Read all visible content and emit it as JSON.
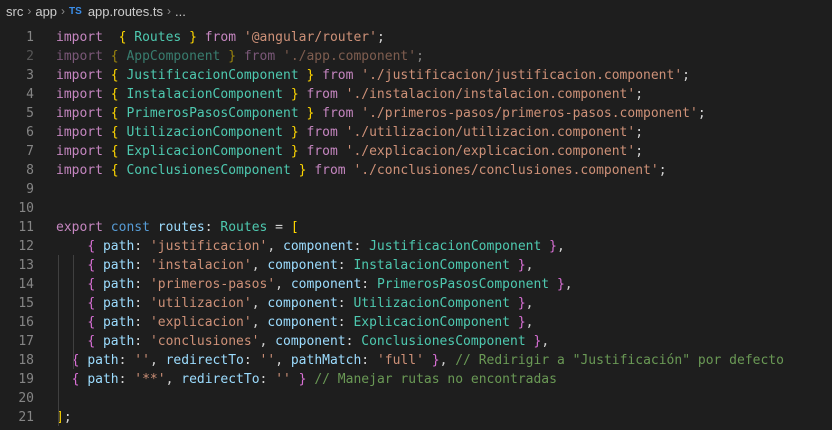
{
  "breadcrumb": {
    "segments": [
      "src",
      "app"
    ],
    "file_icon": "TS",
    "file_name": "app.routes.ts",
    "tail": "..."
  },
  "editor": {
    "language": "typescript",
    "lines": [
      {
        "n": "1",
        "tokens": [
          [
            "kw",
            "import"
          ],
          [
            "",
            "  "
          ],
          [
            "br1",
            "{"
          ],
          [
            "",
            " "
          ],
          [
            "ty",
            "Routes"
          ],
          [
            "",
            " "
          ],
          [
            "br1",
            "}"
          ],
          [
            "",
            " "
          ],
          [
            "kw",
            "from"
          ],
          [
            "",
            " "
          ],
          [
            "str",
            "'@angular/router'"
          ],
          [
            "",
            ";"
          ]
        ]
      },
      {
        "n": "2",
        "dim": true,
        "tokens": [
          [
            "kw",
            "import"
          ],
          [
            "",
            " "
          ],
          [
            "br1",
            "{"
          ],
          [
            "",
            " "
          ],
          [
            "ty",
            "AppComponent"
          ],
          [
            "",
            " "
          ],
          [
            "br1",
            "}"
          ],
          [
            "",
            " "
          ],
          [
            "kw",
            "from"
          ],
          [
            "",
            " "
          ],
          [
            "str",
            "'./app.component'"
          ],
          [
            "",
            ";"
          ]
        ]
      },
      {
        "n": "3",
        "tokens": [
          [
            "kw",
            "import"
          ],
          [
            "",
            " "
          ],
          [
            "br1",
            "{"
          ],
          [
            "",
            " "
          ],
          [
            "ty",
            "JustificacionComponent"
          ],
          [
            "",
            " "
          ],
          [
            "br1",
            "}"
          ],
          [
            "",
            " "
          ],
          [
            "kw",
            "from"
          ],
          [
            "",
            " "
          ],
          [
            "str",
            "'./justificacion/justificacion.component'"
          ],
          [
            "",
            ";"
          ]
        ]
      },
      {
        "n": "4",
        "tokens": [
          [
            "kw",
            "import"
          ],
          [
            "",
            " "
          ],
          [
            "br1",
            "{"
          ],
          [
            "",
            " "
          ],
          [
            "ty",
            "InstalacionComponent"
          ],
          [
            "",
            " "
          ],
          [
            "br1",
            "}"
          ],
          [
            "",
            " "
          ],
          [
            "kw",
            "from"
          ],
          [
            "",
            " "
          ],
          [
            "str",
            "'./instalacion/instalacion.component'"
          ],
          [
            "",
            ";"
          ]
        ]
      },
      {
        "n": "5",
        "tokens": [
          [
            "kw",
            "import"
          ],
          [
            "",
            " "
          ],
          [
            "br1",
            "{"
          ],
          [
            "",
            " "
          ],
          [
            "ty",
            "PrimerosPasosComponent"
          ],
          [
            "",
            " "
          ],
          [
            "br1",
            "}"
          ],
          [
            "",
            " "
          ],
          [
            "kw",
            "from"
          ],
          [
            "",
            " "
          ],
          [
            "str",
            "'./primeros-pasos/primeros-pasos.component'"
          ],
          [
            "",
            ";"
          ]
        ]
      },
      {
        "n": "6",
        "tokens": [
          [
            "kw",
            "import"
          ],
          [
            "",
            " "
          ],
          [
            "br1",
            "{"
          ],
          [
            "",
            " "
          ],
          [
            "ty",
            "UtilizacionComponent"
          ],
          [
            "",
            " "
          ],
          [
            "br1",
            "}"
          ],
          [
            "",
            " "
          ],
          [
            "kw",
            "from"
          ],
          [
            "",
            " "
          ],
          [
            "str",
            "'./utilizacion/utilizacion.component'"
          ],
          [
            "",
            ";"
          ]
        ]
      },
      {
        "n": "7",
        "tokens": [
          [
            "kw",
            "import"
          ],
          [
            "",
            " "
          ],
          [
            "br1",
            "{"
          ],
          [
            "",
            " "
          ],
          [
            "ty",
            "ExplicacionComponent"
          ],
          [
            "",
            " "
          ],
          [
            "br1",
            "}"
          ],
          [
            "",
            " "
          ],
          [
            "kw",
            "from"
          ],
          [
            "",
            " "
          ],
          [
            "str",
            "'./explicacion/explicacion.component'"
          ],
          [
            "",
            ";"
          ]
        ]
      },
      {
        "n": "8",
        "tokens": [
          [
            "kw",
            "import"
          ],
          [
            "",
            " "
          ],
          [
            "br1",
            "{"
          ],
          [
            "",
            " "
          ],
          [
            "ty",
            "ConclusionesComponent"
          ],
          [
            "",
            " "
          ],
          [
            "br1",
            "}"
          ],
          [
            "",
            " "
          ],
          [
            "kw",
            "from"
          ],
          [
            "",
            " "
          ],
          [
            "str",
            "'./conclusiones/conclusiones.component'"
          ],
          [
            "",
            ";"
          ]
        ]
      },
      {
        "n": "9",
        "tokens": []
      },
      {
        "n": "10",
        "tokens": []
      },
      {
        "n": "11",
        "tokens": [
          [
            "kw",
            "export"
          ],
          [
            "",
            " "
          ],
          [
            "kwb",
            "const"
          ],
          [
            "",
            " "
          ],
          [
            "var",
            "routes"
          ],
          [
            "",
            ": "
          ],
          [
            "ty",
            "Routes"
          ],
          [
            "",
            " = "
          ],
          [
            "br1",
            "["
          ]
        ]
      },
      {
        "n": "12",
        "tokens": [
          [
            "",
            "    "
          ],
          [
            "br2",
            "{"
          ],
          [
            "",
            " "
          ],
          [
            "var",
            "path"
          ],
          [
            "",
            ": "
          ],
          [
            "str",
            "'justificacion'"
          ],
          [
            "",
            ", "
          ],
          [
            "var",
            "component"
          ],
          [
            "",
            ": "
          ],
          [
            "ty",
            "JustificacionComponent"
          ],
          [
            "",
            " "
          ],
          [
            "br2",
            "}"
          ],
          [
            "",
            ","
          ]
        ]
      },
      {
        "n": "13",
        "tokens": [
          [
            "",
            "    "
          ],
          [
            "br2",
            "{"
          ],
          [
            "",
            " "
          ],
          [
            "var",
            "path"
          ],
          [
            "",
            ": "
          ],
          [
            "str",
            "'instalacion'"
          ],
          [
            "",
            ", "
          ],
          [
            "var",
            "component"
          ],
          [
            "",
            ": "
          ],
          [
            "ty",
            "InstalacionComponent"
          ],
          [
            "",
            " "
          ],
          [
            "br2",
            "}"
          ],
          [
            "",
            ","
          ]
        ]
      },
      {
        "n": "14",
        "tokens": [
          [
            "",
            "    "
          ],
          [
            "br2",
            "{"
          ],
          [
            "",
            " "
          ],
          [
            "var",
            "path"
          ],
          [
            "",
            ": "
          ],
          [
            "str",
            "'primeros-pasos'"
          ],
          [
            "",
            ", "
          ],
          [
            "var",
            "component"
          ],
          [
            "",
            ": "
          ],
          [
            "ty",
            "PrimerosPasosComponent"
          ],
          [
            "",
            " "
          ],
          [
            "br2",
            "}"
          ],
          [
            "",
            ","
          ]
        ]
      },
      {
        "n": "15",
        "tokens": [
          [
            "",
            "    "
          ],
          [
            "br2",
            "{"
          ],
          [
            "",
            " "
          ],
          [
            "var",
            "path"
          ],
          [
            "",
            ": "
          ],
          [
            "str",
            "'utilizacion'"
          ],
          [
            "",
            ", "
          ],
          [
            "var",
            "component"
          ],
          [
            "",
            ": "
          ],
          [
            "ty",
            "UtilizacionComponent"
          ],
          [
            "",
            " "
          ],
          [
            "br2",
            "}"
          ],
          [
            "",
            ","
          ]
        ]
      },
      {
        "n": "16",
        "tokens": [
          [
            "",
            "    "
          ],
          [
            "br2",
            "{"
          ],
          [
            "",
            " "
          ],
          [
            "var",
            "path"
          ],
          [
            "",
            ": "
          ],
          [
            "str",
            "'explicacion'"
          ],
          [
            "",
            ", "
          ],
          [
            "var",
            "component"
          ],
          [
            "",
            ": "
          ],
          [
            "ty",
            "ExplicacionComponent"
          ],
          [
            "",
            " "
          ],
          [
            "br2",
            "}"
          ],
          [
            "",
            ","
          ]
        ]
      },
      {
        "n": "17",
        "tokens": [
          [
            "",
            "    "
          ],
          [
            "br2",
            "{"
          ],
          [
            "",
            " "
          ],
          [
            "var",
            "path"
          ],
          [
            "",
            ": "
          ],
          [
            "str",
            "'conclusiones'"
          ],
          [
            "",
            ", "
          ],
          [
            "var",
            "component"
          ],
          [
            "",
            ": "
          ],
          [
            "ty",
            "ConclusionesComponent"
          ],
          [
            "",
            " "
          ],
          [
            "br2",
            "}"
          ],
          [
            "",
            ","
          ]
        ]
      },
      {
        "n": "18",
        "tokens": [
          [
            "",
            "  "
          ],
          [
            "br2",
            "{"
          ],
          [
            "",
            " "
          ],
          [
            "var",
            "path"
          ],
          [
            "",
            ": "
          ],
          [
            "str",
            "''"
          ],
          [
            "",
            ", "
          ],
          [
            "var",
            "redirectTo"
          ],
          [
            "",
            ": "
          ],
          [
            "str",
            "''"
          ],
          [
            "",
            ", "
          ],
          [
            "var",
            "pathMatch"
          ],
          [
            "",
            ": "
          ],
          [
            "str",
            "'full'"
          ],
          [
            "",
            " "
          ],
          [
            "br2",
            "}"
          ],
          [
            "",
            ", "
          ],
          [
            "cm",
            "// Redirigir a \"Justificación\" por defecto"
          ]
        ]
      },
      {
        "n": "19",
        "tokens": [
          [
            "",
            "  "
          ],
          [
            "br2",
            "{"
          ],
          [
            "",
            " "
          ],
          [
            "var",
            "path"
          ],
          [
            "",
            ": "
          ],
          [
            "str",
            "'**'"
          ],
          [
            "",
            ", "
          ],
          [
            "var",
            "redirectTo"
          ],
          [
            "",
            ": "
          ],
          [
            "str",
            "''"
          ],
          [
            "",
            " "
          ],
          [
            "br2",
            "}"
          ],
          [
            "",
            " "
          ],
          [
            "cm",
            "// Manejar rutas no encontradas"
          ]
        ]
      },
      {
        "n": "20",
        "tokens": []
      },
      {
        "n": "21",
        "tokens": [
          [
            "br1",
            "]"
          ],
          [
            "",
            ";"
          ]
        ]
      }
    ]
  }
}
